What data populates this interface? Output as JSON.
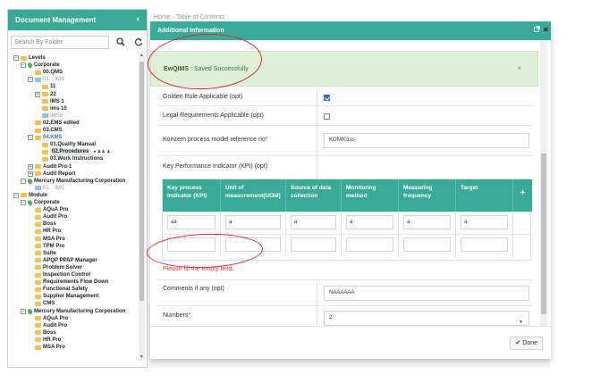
{
  "left_panel": {
    "title": "Document Management",
    "collapse_glyph": "‹",
    "search_placeholder": "Search By Folder",
    "search_icon": "search-icon",
    "refresh_icon": "refresh-icon",
    "tree": [
      {
        "label": "Levels",
        "depth": 0,
        "toggle": "-",
        "icon": "folder",
        "style": "bold"
      },
      {
        "label": "Corporate",
        "depth": 1,
        "toggle": "-",
        "icon": "pin",
        "style": "bold"
      },
      {
        "label": "00.QMS",
        "depth": 2,
        "toggle": "",
        "icon": "folder",
        "style": "bold"
      },
      {
        "label": "01. : IMS",
        "depth": 2,
        "toggle": "-",
        "icon": "folder",
        "style": "gray"
      },
      {
        "label": "11",
        "depth": 3,
        "toggle": "",
        "icon": "folder",
        "style": "bold"
      },
      {
        "label": "22",
        "depth": 3,
        "toggle": "+",
        "icon": "folder",
        "style": "bold"
      },
      {
        "label": "IMS 1",
        "depth": 3,
        "toggle": "",
        "icon": "folder",
        "style": "bold"
      },
      {
        "label": "ims 10",
        "depth": 3,
        "toggle": "",
        "icon": "folder",
        "style": "bold"
      },
      {
        "label": "IMS9",
        "depth": 3,
        "toggle": "",
        "icon": "folder",
        "style": "gray"
      },
      {
        "label": "02.EMS edited",
        "depth": 2,
        "toggle": "",
        "icon": "folder",
        "style": "bold"
      },
      {
        "label": "03.CMS",
        "depth": 2,
        "toggle": "",
        "icon": "folder",
        "style": "bold"
      },
      {
        "label": "04.KMS",
        "depth": 2,
        "toggle": "-",
        "icon": "folder",
        "style": "link"
      },
      {
        "label": "01.Quality Manual",
        "depth": 3,
        "toggle": "",
        "icon": "folder",
        "style": "bold"
      },
      {
        "label": "02.Procedures",
        "depth": 3,
        "toggle": "",
        "icon": "folder",
        "style": "selected"
      },
      {
        "label": "03.Work Instructions",
        "depth": 3,
        "toggle": "",
        "icon": "folder",
        "style": "bold"
      },
      {
        "label": "Audit Pro-1",
        "depth": 2,
        "toggle": "+",
        "icon": "folder",
        "style": "bold"
      },
      {
        "label": "Audit Report",
        "depth": 2,
        "toggle": "+",
        "icon": "folder",
        "style": "bold"
      },
      {
        "label": "Mercury Manufacturing Corporation",
        "depth": 1,
        "toggle": "-",
        "icon": "pin",
        "style": "bold"
      },
      {
        "label": "01. : IMS",
        "depth": 2,
        "toggle": "",
        "icon": "folder",
        "style": "gray"
      },
      {
        "label": "Module",
        "depth": 0,
        "toggle": "-",
        "icon": "folder",
        "style": "bold"
      },
      {
        "label": "Corporate",
        "depth": 1,
        "toggle": "-",
        "icon": "pin",
        "style": "bold"
      },
      {
        "label": "AQuA Pro",
        "depth": 2,
        "toggle": "",
        "icon": "folder",
        "style": "bold"
      },
      {
        "label": "Audit Pro",
        "depth": 2,
        "toggle": "",
        "icon": "folder",
        "style": "bold"
      },
      {
        "label": "Boss",
        "depth": 2,
        "toggle": "",
        "icon": "folder",
        "style": "bold"
      },
      {
        "label": "HR Pro",
        "depth": 2,
        "toggle": "",
        "icon": "folder",
        "style": "bold"
      },
      {
        "label": "MSA Pro",
        "depth": 2,
        "toggle": "",
        "icon": "folder",
        "style": "bold"
      },
      {
        "label": "TPM Pro",
        "depth": 2,
        "toggle": "",
        "icon": "folder",
        "style": "bold"
      },
      {
        "label": "Suite",
        "depth": 2,
        "toggle": "",
        "icon": "folder",
        "style": "bold"
      },
      {
        "label": "APQP PPAP Manager",
        "depth": 2,
        "toggle": "",
        "icon": "folder",
        "style": "bold"
      },
      {
        "label": "Problem Solver",
        "depth": 2,
        "toggle": "",
        "icon": "folder",
        "style": "bold"
      },
      {
        "label": "Inspection Control",
        "depth": 2,
        "toggle": "",
        "icon": "folder",
        "style": "bold"
      },
      {
        "label": "Requirements Flow Down",
        "depth": 2,
        "toggle": "",
        "icon": "folder",
        "style": "bold"
      },
      {
        "label": "Functional Safety",
        "depth": 2,
        "toggle": "",
        "icon": "folder",
        "style": "bold"
      },
      {
        "label": "Supplier Management",
        "depth": 2,
        "toggle": "",
        "icon": "folder",
        "style": "bold"
      },
      {
        "label": "CMS",
        "depth": 2,
        "toggle": "",
        "icon": "folder",
        "style": "bold"
      },
      {
        "label": "Mercury Manufacturing Corporation",
        "depth": 1,
        "toggle": "-",
        "icon": "pin",
        "style": "bold"
      },
      {
        "label": "AQuA Pro",
        "depth": 2,
        "toggle": "",
        "icon": "folder",
        "style": "bold"
      },
      {
        "label": "Audit Pro",
        "depth": 2,
        "toggle": "",
        "icon": "folder",
        "style": "bold"
      },
      {
        "label": "Boss",
        "depth": 2,
        "toggle": "",
        "icon": "folder",
        "style": "bold"
      },
      {
        "label": "HR Pro",
        "depth": 2,
        "toggle": "",
        "icon": "folder",
        "style": "bold"
      },
      {
        "label": "MSA Pro",
        "depth": 2,
        "toggle": "",
        "icon": "folder",
        "style": "bold"
      }
    ]
  },
  "background": {
    "breadcrumb": "Home  ›  Table of Contents"
  },
  "modal": {
    "title": "Additional Information",
    "header_icons": [
      "external-link-icon",
      "close-icon"
    ],
    "alert": {
      "brand": "EwQIMS",
      "message": ": Saved Successfully",
      "close": "×"
    },
    "fields": {
      "golden_rule": {
        "label": "Golden Rule Applicable (opt)",
        "checked": true
      },
      "legal_req": {
        "label": "Legal Requirements Applicable (opt)",
        "checked": false
      },
      "konzern": {
        "label": "Konzern process model reference no",
        "required_mark": "*",
        "value": "KON001ss"
      },
      "kpi_label": "Key Performance Indicator (KPI) (opt)",
      "comments": {
        "label": "Comments if any (opt)",
        "value": "NAAAAAA"
      },
      "numbers": {
        "label": "Numbers",
        "required_mark": "*",
        "value": "2"
      }
    },
    "kpi_table": {
      "headers": [
        "Key process Indicator (KPI)",
        "Unit of measurement(UOM)",
        "Source of data collection",
        "Monitoring method",
        "Measuring frequency",
        "Target",
        "+"
      ],
      "rows": [
        [
          "aa",
          "a",
          "a",
          "a",
          "a",
          "a"
        ],
        [
          "",
          "",
          "",
          "",
          "",
          ""
        ]
      ]
    },
    "error_text": "Please fill the empty field.",
    "done_label": "Done",
    "done_icon": "check-icon"
  },
  "colors": {
    "accent": "#3aaa98",
    "alert_bg": "#dff0d8",
    "error": "#e03b3b",
    "annotation": "#e0282c"
  }
}
